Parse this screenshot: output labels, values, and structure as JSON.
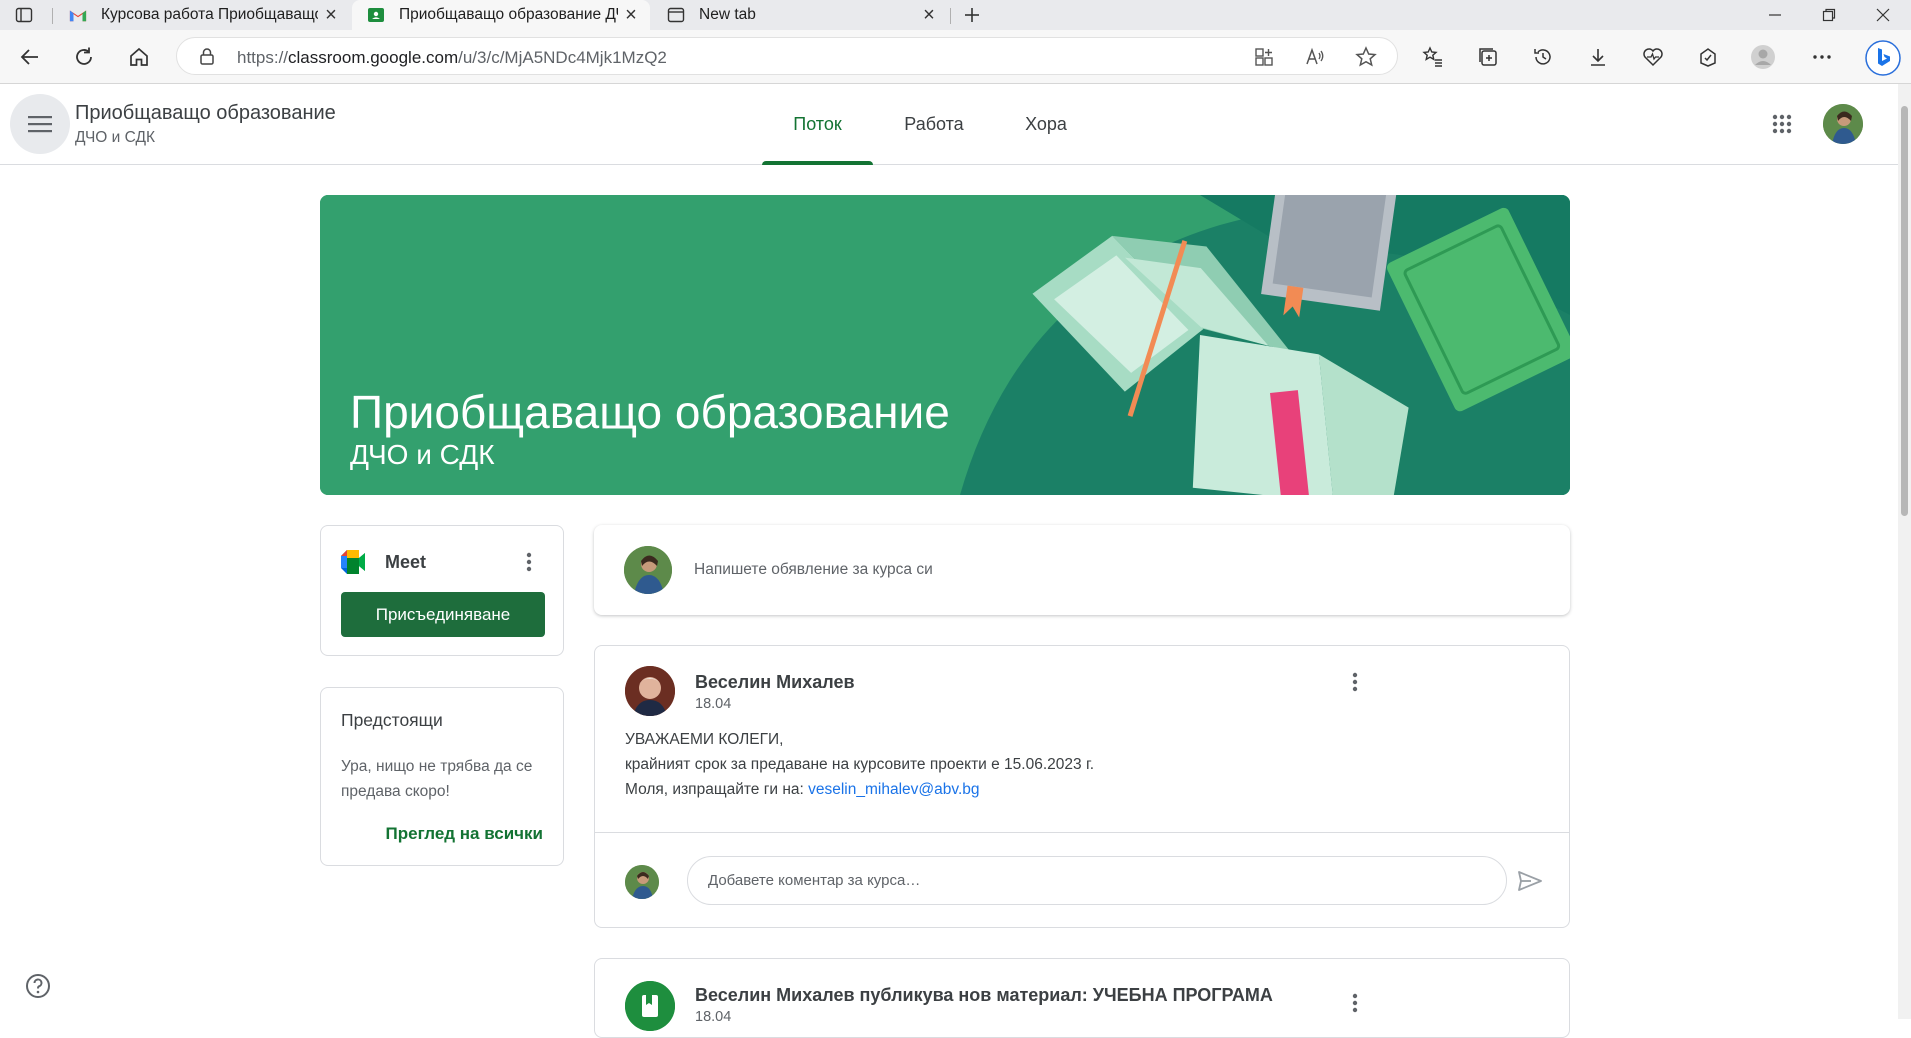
{
  "browser": {
    "tabs": [
      {
        "label": "Курсова работа Приобщаващо",
        "icon": "gmail-icon",
        "badge": "0"
      },
      {
        "label": "Приобщаващо образование ДЧ",
        "icon": "classroom-icon"
      },
      {
        "label": "New tab",
        "icon": "new-tab-icon"
      }
    ],
    "url_prefix": "https://",
    "url_host": "classroom.google.com",
    "url_path": "/u/3/c/MjA5NDc4Mjk1MzQ2"
  },
  "header": {
    "class_title": "Приобщаващо образование",
    "class_section": "ДЧО и СДК",
    "tabs": [
      {
        "label": "Поток",
        "active": true
      },
      {
        "label": "Работа",
        "active": false
      },
      {
        "label": "Хора",
        "active": false
      }
    ]
  },
  "banner": {
    "title": "Приобщаващо образование",
    "subtitle": "ДЧО и СДК",
    "color": "#33a06e"
  },
  "meet": {
    "label": "Meet",
    "join_label": "Присъединяване"
  },
  "upcoming": {
    "title": "Предстоящи",
    "empty_text": "Ура, нищо не трябва да се предава скоро!",
    "view_all": "Преглед на всички"
  },
  "announce": {
    "placeholder": "Напишете обявление за курса си"
  },
  "post": {
    "author": "Веселин Михалев",
    "date": "18.04",
    "lines": [
      "УВАЖАЕМИ КОЛЕГИ,",
      "крайният срок за предаване на курсовите проекти е 15.06.2023 г.",
      "Моля, изпращайте ги на: "
    ],
    "email": "veselin_mihalev@abv.bg",
    "comment_placeholder": "Добавете коментар за курса…"
  },
  "material": {
    "title": "Веселин Михалев публикува нов материал: УЧЕБНА ПРОГРАМА",
    "date": "18.04"
  },
  "colors": {
    "accent_green": "#137333",
    "button_green": "#1e6d3c",
    "link_blue": "#1a73e8"
  }
}
